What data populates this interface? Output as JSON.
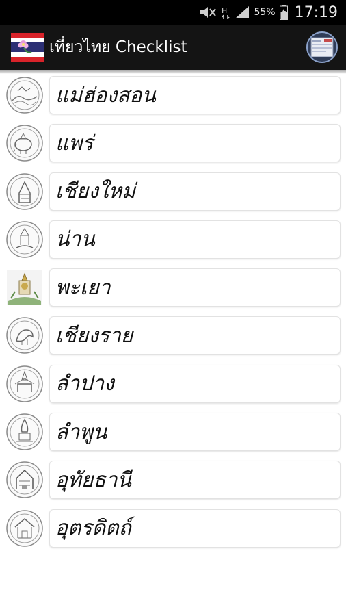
{
  "status_bar": {
    "battery_percent": "55%",
    "time": "17:19",
    "network_label": "H",
    "icons": [
      "mute-icon",
      "network-h-icon",
      "signal-icon",
      "battery-icon"
    ]
  },
  "app_bar": {
    "title": "เที่ยวไทย Checklist",
    "logo_icon": "thai-flag-icon",
    "menu_icon": "checklist-thumbnail-icon",
    "colors": {
      "flag_red": "#d8232a",
      "flag_white": "#ffffff",
      "flag_blue": "#2b2f74",
      "bar_bg": "#141414"
    }
  },
  "provinces": [
    {
      "name": "แม่ฮ่องสอน",
      "seal_icon": "mae-hong-son-seal-icon"
    },
    {
      "name": "แพร่",
      "seal_icon": "phrae-seal-icon"
    },
    {
      "name": "เชียงใหม่",
      "seal_icon": "chiang-mai-seal-icon"
    },
    {
      "name": "น่าน",
      "seal_icon": "nan-seal-icon"
    },
    {
      "name": "พะเยา",
      "seal_icon": "phayao-seal-icon"
    },
    {
      "name": "เชียงราย",
      "seal_icon": "chiang-rai-seal-icon"
    },
    {
      "name": "ลำปาง",
      "seal_icon": "lampang-seal-icon"
    },
    {
      "name": "ลำพูน",
      "seal_icon": "lamphun-seal-icon"
    },
    {
      "name": "อุทัยธานี",
      "seal_icon": "uthai-thani-seal-icon"
    },
    {
      "name": "อุตรดิตถ์",
      "seal_icon": "uttaradit-seal-icon"
    }
  ]
}
